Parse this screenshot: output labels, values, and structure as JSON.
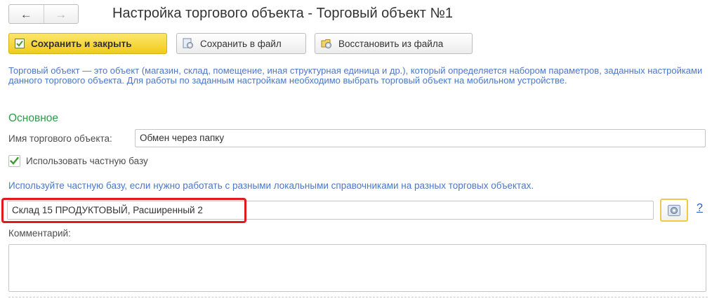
{
  "window": {
    "title": "Настройка торгового объекта - Торговый объект №1",
    "nav": {
      "back_icon": "arrow-left-icon",
      "forward_icon": "arrow-right-icon"
    }
  },
  "toolbar": {
    "save_close_label": "Сохранить и закрыть",
    "save_file_label": "Сохранить в файл",
    "restore_file_label": "Восстановить из файла"
  },
  "description": "Торговый объект — это объект (магазин, склад, помещение, иная структурная единица и др.), который определяется набором параметров, заданных настройками данного торгового объекта. Для работы по заданным настройкам необходимо выбрать торговый объект на мобильном устройстве.",
  "main": {
    "section_title": "Основное",
    "name_label": "Имя торгового объекта:",
    "name_value": "Обмен через папку",
    "private_base_checkbox_label": "Использовать частную базу",
    "private_base_checked": true,
    "private_base_hint": "Используйте частную базу, если нужно работать с разными локальными справочниками на разных торговых объектах.",
    "base_value": "Склад 15 ПРОДУКТОВЫЙ, Расширенный 2",
    "help_label": "?",
    "comment_label": "Комментарий:",
    "comment_value": ""
  },
  "colors": {
    "accent_yellow": "#f2cb1d",
    "info_text": "#4a78c8",
    "section_green": "#2e9a49",
    "highlight_red": "#e0191b"
  }
}
